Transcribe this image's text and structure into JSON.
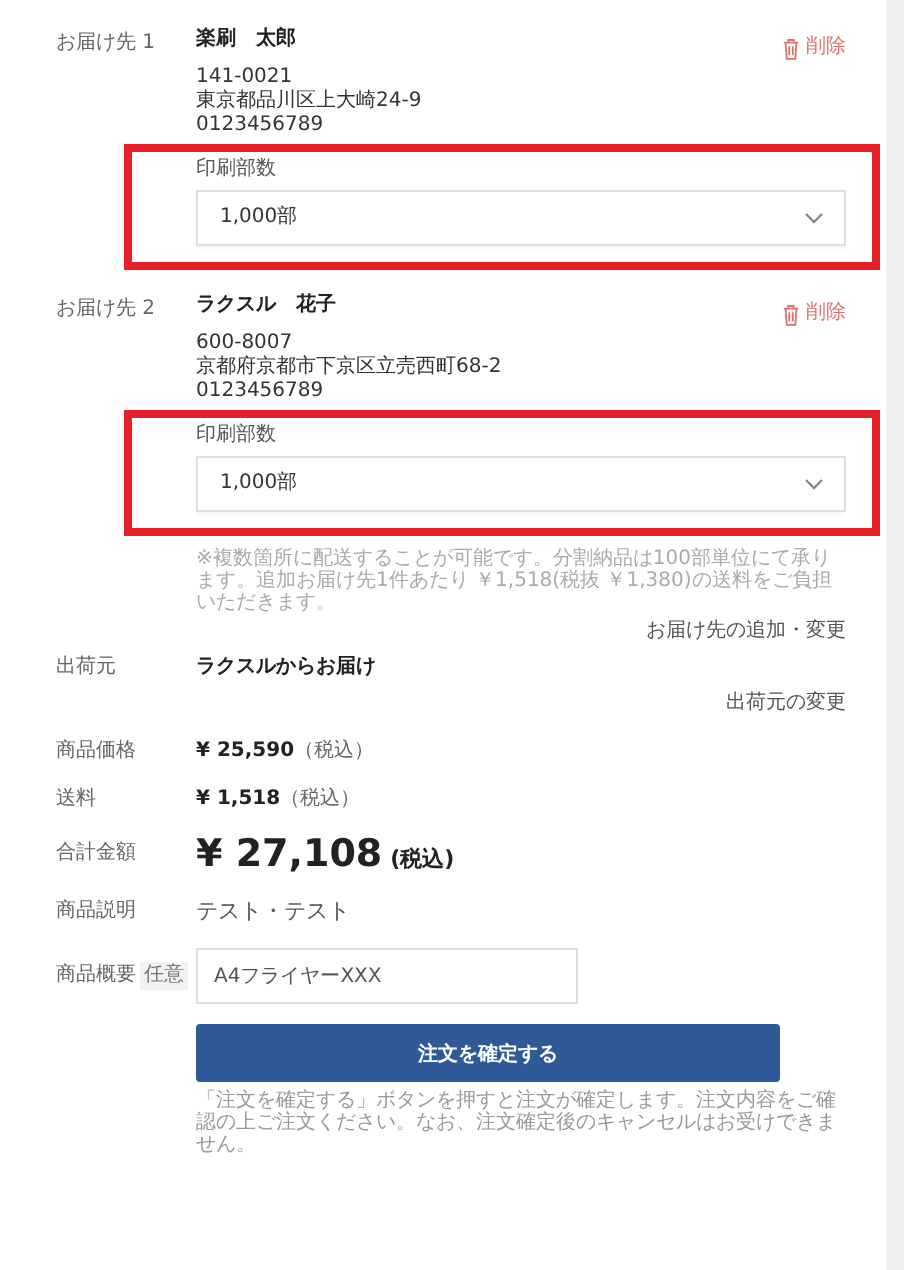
{
  "recipients": [
    {
      "label": "お届け先 1",
      "name": "楽刷　太郎",
      "postal": "141-0021",
      "address": "東京都品川区上大崎24-9",
      "phone": "0123456789",
      "delete": "削除",
      "quantity": {
        "label": "印刷部数",
        "value": "1,000部"
      },
      "highlighted": true
    },
    {
      "label": "お届け先 2",
      "name": "ラクスル　花子",
      "postal": "600-8007",
      "address": "京都府京都市下京区立売西町68-2",
      "phone": "0123456789",
      "delete": "削除",
      "quantity": {
        "label": "印刷部数",
        "value": "1,000部"
      },
      "highlighted": true
    }
  ],
  "note": "※複数箇所に配送することが可能です。分割納品は100部単位にて承ります。追加お届け先1件あたり ￥1,518(税抜 ￥1,380)の送料をご負担いただきます。",
  "recipients_link": "お届け先の追加・変更",
  "shipper": {
    "label": "出荷元",
    "value": "ラクスルからお届け",
    "link": "出荷元の変更"
  },
  "price": {
    "label": "商品価格",
    "amount": "¥ 25,590",
    "tax": "（税込）"
  },
  "shipping": {
    "label": "送料",
    "amount": "¥ 1,518",
    "tax": "（税込）"
  },
  "total": {
    "label": "合計金額",
    "amount": "¥ 27,108",
    "tax": "(税込)"
  },
  "description": {
    "label": "商品説明",
    "value": "テスト・テスト"
  },
  "summary": {
    "label": "商品概要",
    "badge": "任意",
    "value": "A4フライヤーXXX"
  },
  "submit": "注文を確定する",
  "footer_note": "「注文を確定する」ボタンを押すと注文が確定します。注文内容をご確認の上ご注文ください。なお、注文確定後のキャンセルはお受けできません。"
}
